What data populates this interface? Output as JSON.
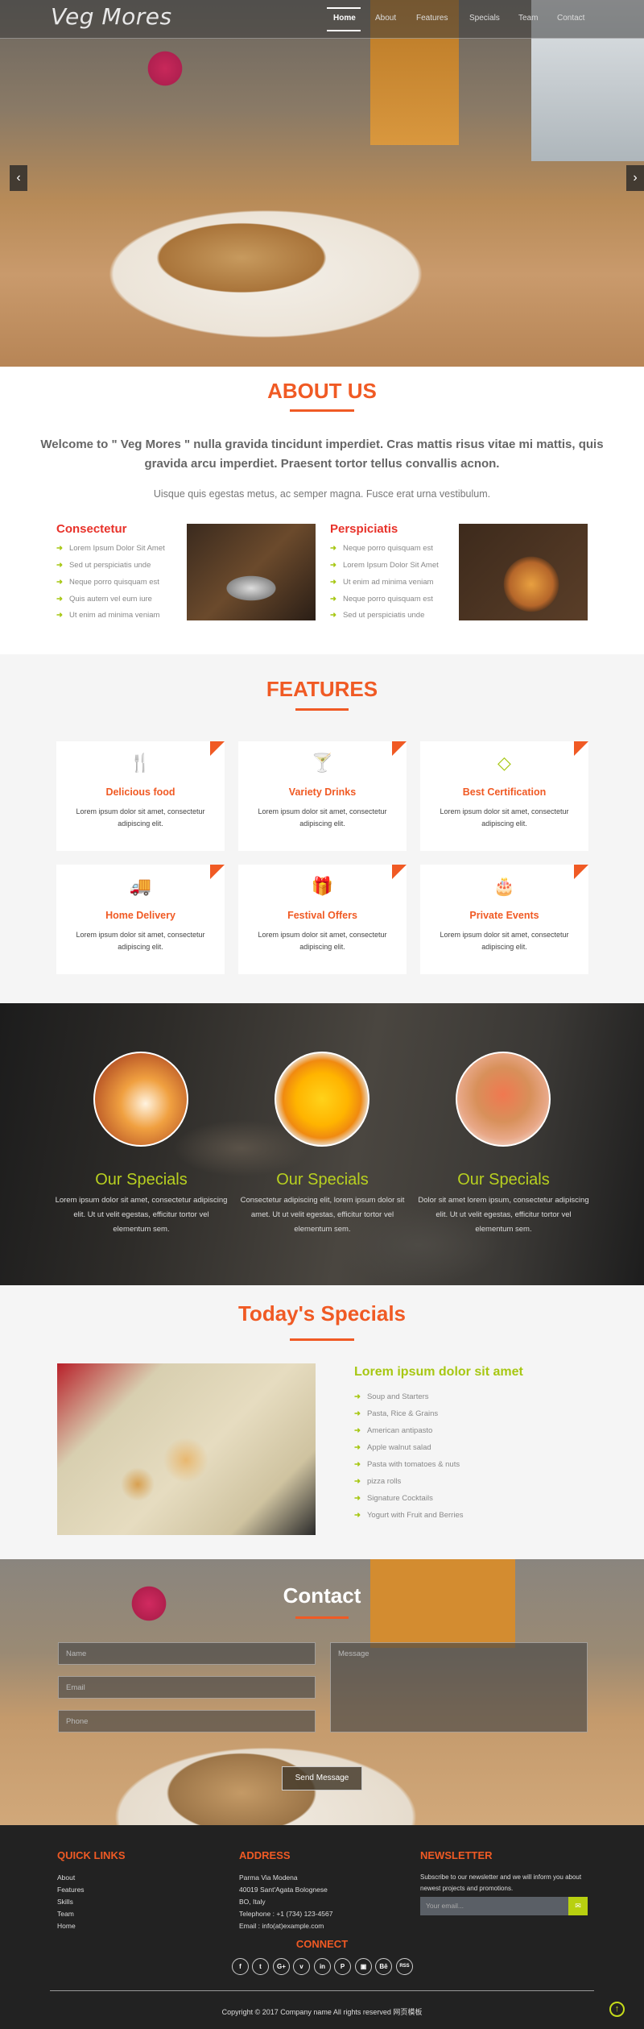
{
  "nav": {
    "logo": "Veg Mores",
    "items": [
      "Home",
      "About",
      "Features",
      "Specials",
      "Team",
      "Contact"
    ],
    "active": "Home",
    "prev": "‹",
    "next": "›"
  },
  "about": {
    "title": "ABOUT US",
    "welcome": "Welcome to \" Veg Mores \" nulla gravida tincidunt imperdiet. Cras mattis risus vitae mi mattis, quis gravida arcu imperdiet. Praesent tortor tellus convallis acnon.",
    "sub": "Uisque quis egestas metus, ac semper magna. Fusce erat urna vestibulum.",
    "col1": {
      "heading": "Consectetur",
      "items": [
        "Lorem Ipsum Dolor Sit Amet",
        "Sed ut perspiciatis unde",
        "Neque porro quisquam est",
        "Quis autem vel eum iure",
        "Ut enim ad minima veniam"
      ]
    },
    "col2": {
      "heading": "Perspiciatis",
      "items": [
        "Neque porro quisquam est",
        "Lorem Ipsum Dolor Sit Amet",
        "Ut enim ad minima veniam",
        "Neque porro quisquam est",
        "Sed ut perspiciatis unde"
      ]
    }
  },
  "features": {
    "title": "FEATURES",
    "cards": [
      {
        "icon": "cutlery-icon",
        "glyph": "🍴",
        "title": "Delicious food",
        "text": "Lorem ipsum dolor sit amet, consectetur adipiscing elit."
      },
      {
        "icon": "cocktail-icon",
        "glyph": "🍸",
        "title": "Variety Drinks",
        "text": "Lorem ipsum dolor sit amet, consectetur adipiscing elit."
      },
      {
        "icon": "diamond-icon",
        "glyph": "◇",
        "title": "Best Certification",
        "text": "Lorem ipsum dolor sit amet, consectetur adipiscing elit."
      },
      {
        "icon": "truck-icon",
        "glyph": "🚚",
        "title": "Home Delivery",
        "text": "Lorem ipsum dolor sit amet, consectetur adipiscing elit."
      },
      {
        "icon": "gift-icon",
        "glyph": "🎁",
        "title": "Festival Offers",
        "text": "Lorem ipsum dolor sit amet, consectetur adipiscing elit."
      },
      {
        "icon": "birthday-cake-icon",
        "glyph": "🎂",
        "title": "Private Events",
        "text": "Lorem ipsum dolor sit amet, consectetur adipiscing elit."
      }
    ]
  },
  "specials": [
    {
      "title": "Our Specials",
      "text": "Lorem ipsum dolor sit amet, consectetur adipiscing elit. Ut ut velit egestas, efficitur tortor vel elementum sem."
    },
    {
      "title": "Our Specials",
      "text": "Consectetur adipiscing elit, lorem ipsum dolor sit amet. Ut ut velit egestas, efficitur tortor vel elementum sem."
    },
    {
      "title": "Our Specials",
      "text": "Dolor sit amet lorem ipsum, consectetur adipiscing elit. Ut ut velit egestas, efficitur tortor vel elementum sem."
    }
  ],
  "today": {
    "title": "Today's Specials",
    "heading": "Lorem ipsum dolor sit amet",
    "items": [
      "Soup and Starters",
      "Pasta, Rice & Grains",
      "American antipasto",
      "Apple walnut salad",
      "Pasta with tomatoes & nuts",
      "pizza rolls",
      "Signature Cocktails",
      "Yogurt with Fruit and Berries"
    ]
  },
  "contact": {
    "title": "Contact",
    "name_placeholder": "Name",
    "email_placeholder": "Email",
    "phone_placeholder": "Phone",
    "message_placeholder": "Message",
    "send": "Send Message"
  },
  "footer": {
    "quick_links_title": "QUICK LINKS",
    "quick_links": [
      "About",
      "Features",
      "Skills",
      "Team",
      "Home"
    ],
    "address_title": "ADDRESS",
    "address": [
      "Parma Via Modena",
      "40019 Sant'Agata Bolognese",
      "BO, Italy",
      "Telephone : +1 (734) 123-4567",
      "Email : info(at)example.com"
    ],
    "newsletter_title": "NEWSLETTER",
    "newsletter_text": "Subscribe to our newsletter and we will inform you about newest projects and promotions.",
    "email_placeholder": "Your email...",
    "connect_title": "CONNECT",
    "social": [
      "f",
      "t",
      "G+",
      "v",
      "in",
      "P",
      "▣",
      "Bē",
      "RSS"
    ],
    "copyright": "Copyright © 2017 Company name All rights reserved 网页模板"
  },
  "colors": {
    "accent": "#f05a24",
    "green": "#a7c713",
    "footer_bg": "#222222"
  }
}
